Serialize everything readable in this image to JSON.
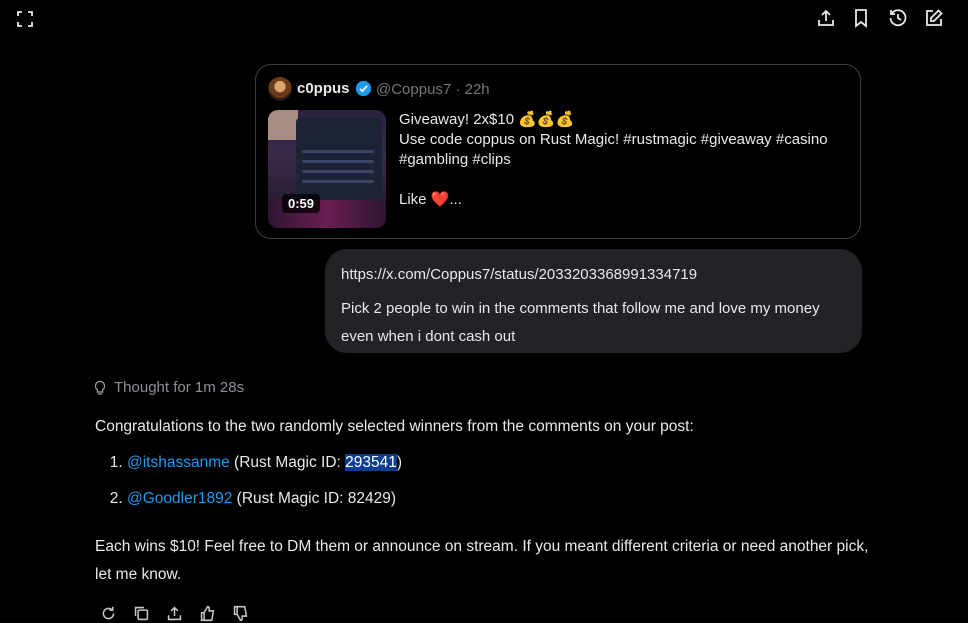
{
  "quoted_post": {
    "author_name": "c0ppus",
    "author_handle_time": "@Coppus7 · 22h",
    "video_duration": "0:59",
    "line1": "Giveaway! 2x$10 💰💰💰",
    "line2": "Use code coppus on Rust Magic! #rustmagic #giveaway #casino",
    "line3": "#gambling #clips",
    "like_text": "Like",
    "like_heart": "❤️",
    "like_ellipsis": "..."
  },
  "user_message": {
    "link": "https://x.com/Coppus7/status/2033203368991334719",
    "text": "Pick 2 people to win in the comments that follow me and love my money even when i dont cash out"
  },
  "response": {
    "thought": "Thought for 1m 28s",
    "intro": "Congratulations to the two randomly selected winners from the comments on your post:",
    "winners": [
      {
        "handle": "@itshassanme",
        "pre": " (Rust Magic ID: ",
        "id": "293541",
        "post": ")"
      },
      {
        "handle": "@Goodler1892",
        "pre": " (Rust Magic ID: ",
        "id": "82429",
        "post": ")"
      }
    ],
    "closing": "Each wins $10! Feel free to DM them or announce on stream. If you meant different criteria or need another pick, let me know."
  },
  "icons": {
    "top_left": "expand-icon",
    "top_right": [
      "share-icon",
      "bookmark-icon",
      "history-icon",
      "edit-icon"
    ],
    "actions": [
      "regenerate-icon",
      "copy-icon",
      "share-icon",
      "thumbs-up-icon",
      "thumbs-down-icon"
    ]
  },
  "colors": {
    "accent": "#1d9bf0",
    "heart": "#f91880",
    "selection": "#0b3e91"
  }
}
